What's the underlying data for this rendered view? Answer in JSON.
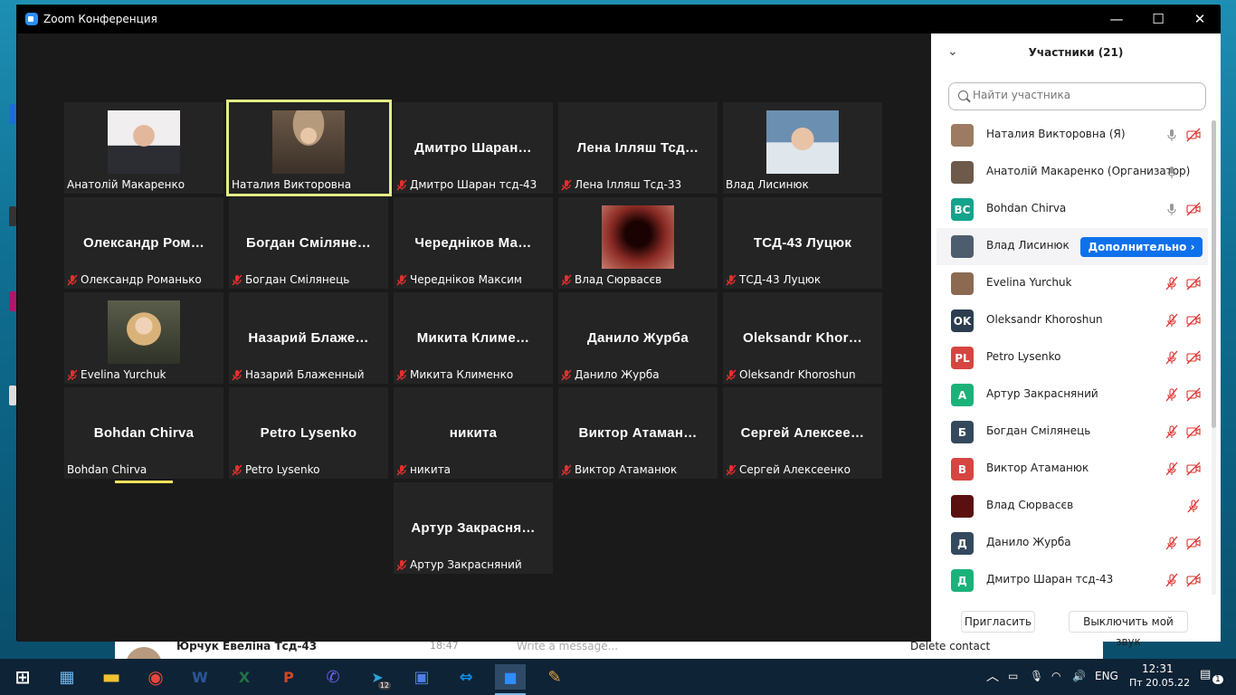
{
  "window": {
    "title": "Zoom Конференция",
    "minimize": "—",
    "maximize": "☐",
    "close": "✕"
  },
  "tiles": [
    {
      "title": "",
      "label": "Анатолій Макаренко",
      "muted": false,
      "photo": "man-suit"
    },
    {
      "title": "",
      "label": "Наталия Викторовна",
      "muted": false,
      "photo": "woman-hat",
      "active": true
    },
    {
      "title": "Дмитро Шаран…",
      "label": "Дмитро Шаран тсд-43",
      "muted": true
    },
    {
      "title": "Лена Ілляш Тсд…",
      "label": "Лена Ілляш Тсд-33",
      "muted": true
    },
    {
      "title": "",
      "label": "Влад Лисинюк",
      "muted": false,
      "photo": "young-man"
    },
    {
      "title": "Олександр Ром…",
      "label": "Олександр Романько",
      "muted": true
    },
    {
      "title": "Богдан Сміляне…",
      "label": "Богдан Смілянець",
      "muted": true
    },
    {
      "title": "Череднiков Ма…",
      "label": "Череднiков Максим",
      "muted": true
    },
    {
      "title": "",
      "label": "Влад Сюрвасєв",
      "muted": true,
      "photo": "blurred"
    },
    {
      "title": "ТСД-43 Луцюк",
      "label": "ТСД-43 Луцюк",
      "muted": true
    },
    {
      "title": "",
      "label": "Evelina Yurchuk",
      "muted": true,
      "photo": "woman-blonde"
    },
    {
      "title": "Назарий Блаже…",
      "label": "Назарий Блаженный",
      "muted": true
    },
    {
      "title": "Микита Климе…",
      "label": "Микита Клименко",
      "muted": true
    },
    {
      "title": "Данило Журба",
      "label": "Данило Журба",
      "muted": true
    },
    {
      "title": "Oleksandr Khor…",
      "label": "Oleksandr Khoroshun",
      "muted": true
    },
    {
      "title": "Bohdan Chirva",
      "label": "Bohdan Chirva",
      "muted": false,
      "speaking": true
    },
    {
      "title": "Petro Lysenko",
      "label": "Petro Lysenko",
      "muted": true
    },
    {
      "title": "никита",
      "label": "никита",
      "muted": true
    },
    {
      "title": "Виктор Атаман…",
      "label": "Виктор Атаманюк",
      "muted": true
    },
    {
      "title": "Сергей Алексее…",
      "label": "Сергей Алексеенко",
      "muted": true
    },
    {
      "title": "Артур Закрасня…",
      "label": "Артур Закрасняний",
      "muted": true
    }
  ],
  "panel": {
    "title": "Участники (21)",
    "search_placeholder": "Найти участника",
    "more_button": "Дополнительно ›",
    "invite_button": "Пригласить",
    "mute_me_button": "Выключить мой звук",
    "participants": [
      {
        "name": "Наталия Викторовна (Я)",
        "avatar": "",
        "color": "#9c7b62",
        "mic": "on",
        "video": "off"
      },
      {
        "name": "Анатолій Макаренко (Организатор)",
        "avatar": "",
        "color": "#6d5a4a",
        "mic": "on",
        "video": "none"
      },
      {
        "name": "Bohdan Chirva",
        "avatar": "BC",
        "color": "#14a38b",
        "mic": "on",
        "video": "off"
      },
      {
        "name": "Влад Лисинюк",
        "avatar": "",
        "color": "#4d5d6d",
        "mic": "none",
        "video": "none",
        "hover": true
      },
      {
        "name": "Evelina Yurchuk",
        "avatar": "",
        "color": "#8c6a52",
        "mic": "off",
        "video": "off"
      },
      {
        "name": "Oleksandr Khoroshun",
        "avatar": "OK",
        "color": "#2c3e50",
        "mic": "off",
        "video": "off"
      },
      {
        "name": "Petro Lysenko",
        "avatar": "PL",
        "color": "#d64541",
        "mic": "off",
        "video": "off"
      },
      {
        "name": "Артур Закрасняний",
        "avatar": "А",
        "color": "#1bb27a",
        "mic": "off",
        "video": "off"
      },
      {
        "name": "Богдан Смілянець",
        "avatar": "Б",
        "color": "#34495e",
        "mic": "off",
        "video": "off"
      },
      {
        "name": "Виктор Атаманюк",
        "avatar": "В",
        "color": "#d64541",
        "mic": "off",
        "video": "off"
      },
      {
        "name": "Влад Сюрвасєв",
        "avatar": "",
        "color": "#5a1010",
        "mic": "off",
        "video": "none"
      },
      {
        "name": "Данило Журба",
        "avatar": "Д",
        "color": "#34495e",
        "mic": "off",
        "video": "off"
      },
      {
        "name": "Дмитро Шаран тсд-43",
        "avatar": "Д",
        "color": "#1bb27a",
        "mic": "off",
        "video": "off"
      }
    ]
  },
  "background_window": {
    "contact": "Юрчук Евеліна Тсд-43",
    "time": "18:47",
    "message_placeholder": "Write a message...",
    "delete": "Delete contact"
  },
  "taskbar": {
    "apps": [
      "windows-logo",
      "file-explorer",
      "folder",
      "chrome",
      "word",
      "excel",
      "powerpoint",
      "viber",
      "telegram",
      "save-disk",
      "teamviewer",
      "zoom",
      "paint"
    ],
    "telegram_badge": "12",
    "language": "ENG",
    "time": "12:31",
    "date": "Пт 20.05.22",
    "notifications": "1"
  }
}
